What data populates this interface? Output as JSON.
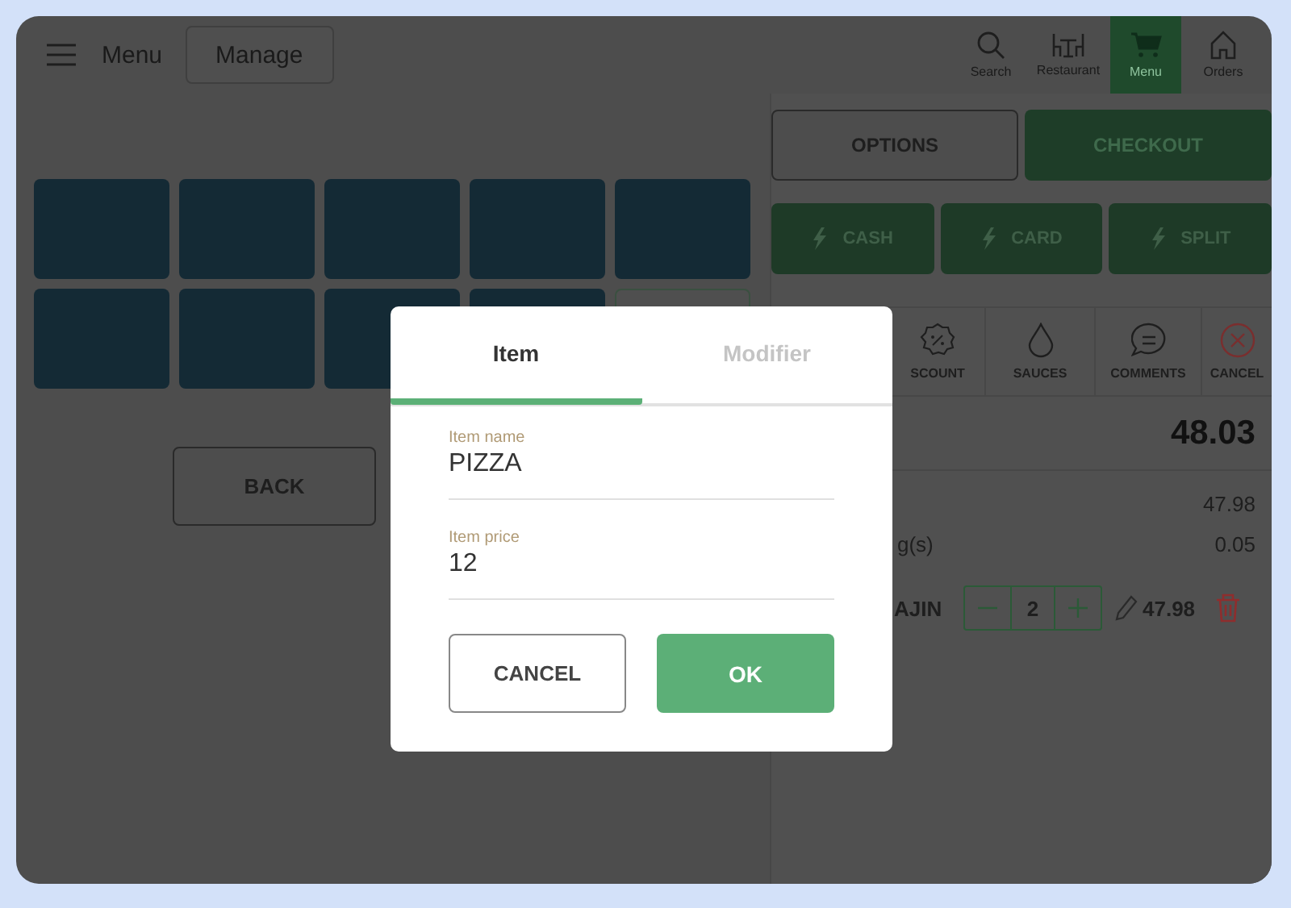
{
  "header": {
    "menu_label": "Menu",
    "manage_button": "Manage"
  },
  "nav": [
    {
      "label": "Search",
      "kind": "search",
      "selected": false
    },
    {
      "label": "Restaurant",
      "kind": "table",
      "selected": false
    },
    {
      "label": "Menu",
      "kind": "cart",
      "selected": true
    },
    {
      "label": "Orders",
      "kind": "home",
      "selected": false
    }
  ],
  "tiles": [
    {
      "kind": "product"
    },
    {
      "kind": "product"
    },
    {
      "kind": "product"
    },
    {
      "kind": "product"
    },
    {
      "kind": "product"
    },
    {
      "kind": "product"
    },
    {
      "kind": "product"
    },
    {
      "kind": "product"
    },
    {
      "kind": "product"
    },
    {
      "kind": "outlined"
    }
  ],
  "back_button": "BACK",
  "actions": [
    {
      "label": "OPTIONS",
      "kind": "outline"
    },
    {
      "label": "CHECKOUT",
      "kind": "filled"
    }
  ],
  "payments": [
    "CASH",
    "CARD",
    "SPLIT"
  ],
  "tools": [
    {
      "label": "SCOUNT",
      "kind": "discount"
    },
    {
      "label": "SAUCES",
      "kind": "drop"
    },
    {
      "label": "COMMENTS",
      "kind": "comment"
    },
    {
      "label": "CANCEL",
      "kind": "cancel"
    }
  ],
  "total": "48.03",
  "summary": [
    {
      "value": "47.98"
    },
    {
      "label": "g(s)",
      "value": "0.05"
    }
  ],
  "order_items": [
    {
      "name": "AJIN",
      "quantity": "2",
      "price": "47.98"
    }
  ],
  "dialog": {
    "tabs": [
      {
        "label": "Item",
        "selected": true
      },
      {
        "label": "Modifier",
        "selected": false
      }
    ],
    "fields": [
      {
        "label": "Item name",
        "value": "PIZZA"
      },
      {
        "label": "Item price",
        "value": "12"
      }
    ],
    "buttons": [
      {
        "label": "CANCEL",
        "kind": "secondary"
      },
      {
        "label": "OK",
        "kind": "primary"
      }
    ]
  }
}
